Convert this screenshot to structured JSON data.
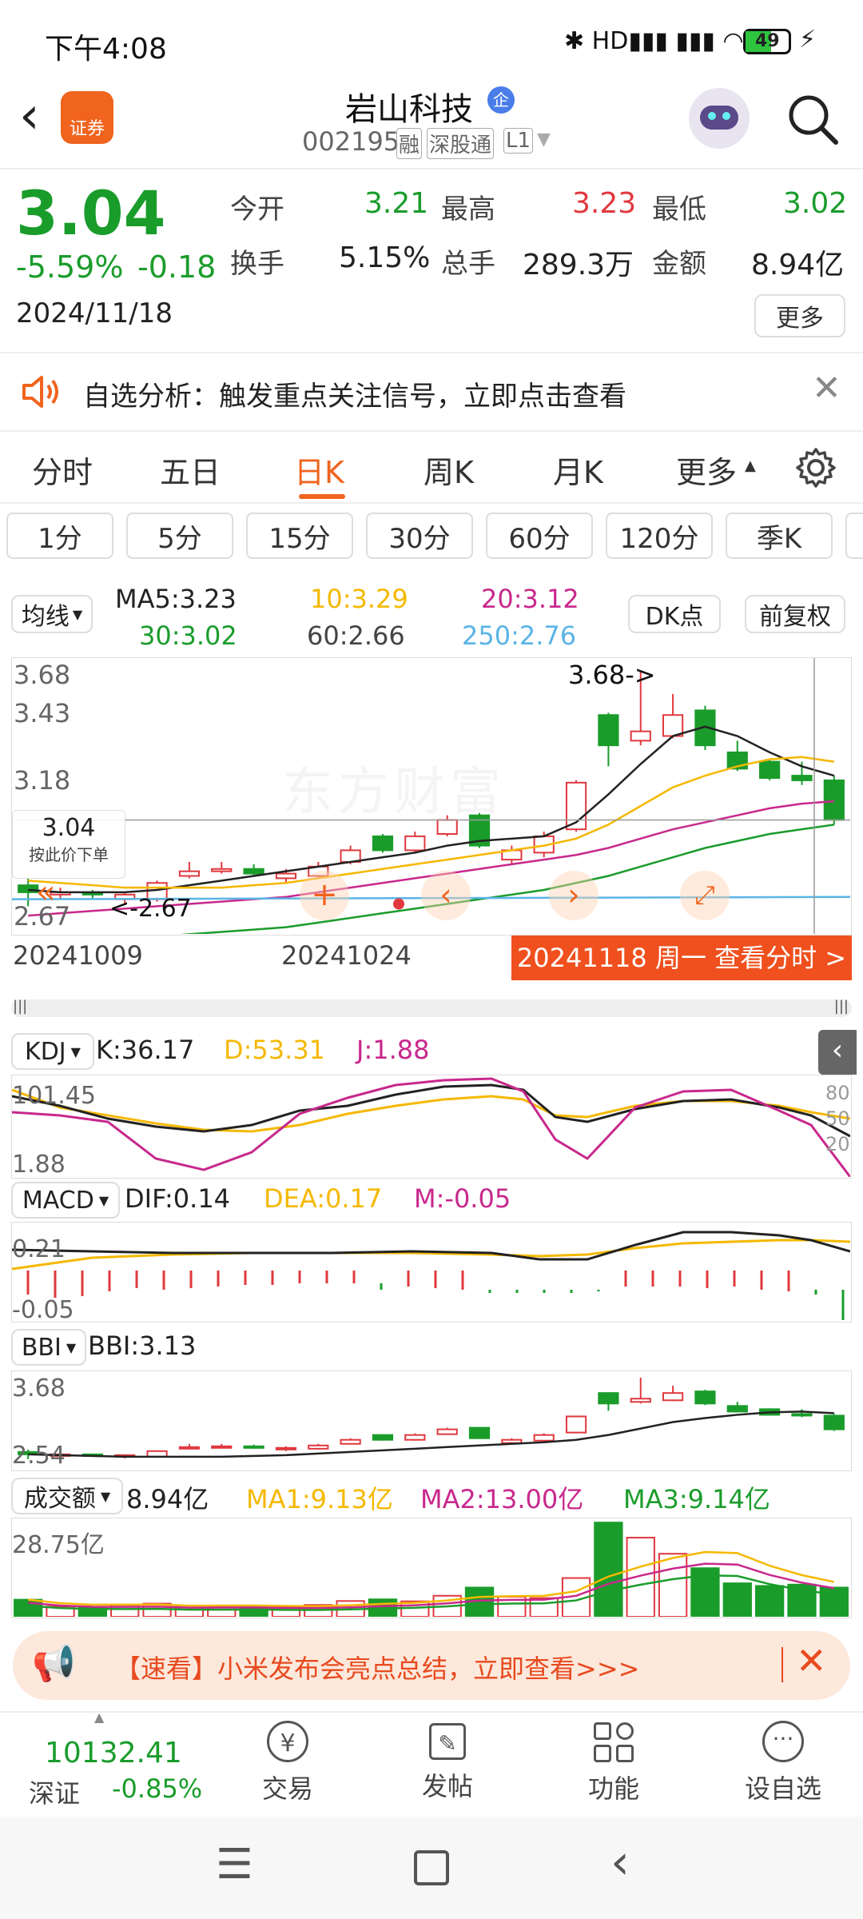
{
  "status": {
    "time": "下午4:08",
    "battery": "49"
  },
  "header": {
    "name": "岩山科技",
    "code": "002195",
    "tags": [
      "融",
      "深股通",
      "L1"
    ],
    "badge": "企",
    "brand": "证券"
  },
  "quote": {
    "price": "3.04",
    "pct": "-5.59%",
    "chg": "-0.18",
    "date": "2024/11/18",
    "fields": [
      {
        "label": "今开",
        "value": "3.21",
        "color": "green"
      },
      {
        "label": "最高",
        "value": "3.23",
        "color": "red"
      },
      {
        "label": "最低",
        "value": "3.02",
        "color": "green"
      },
      {
        "label": "换手",
        "value": "5.15%",
        "color": "black"
      },
      {
        "label": "总手",
        "value": "289.3万",
        "color": "black"
      },
      {
        "label": "金额",
        "value": "8.94亿",
        "color": "black"
      }
    ],
    "more": "更多"
  },
  "notice": {
    "text": "自选分析：触发重点关注信号，立即点击查看"
  },
  "tabs": [
    "分时",
    "五日",
    "日K",
    "周K",
    "月K",
    "更多"
  ],
  "active_tab": "日K",
  "timeframes": [
    "1分",
    "5分",
    "15分",
    "30分",
    "60分",
    "120分",
    "季K"
  ],
  "ma": {
    "selector": "均线",
    "ma5": "MA5:3.23",
    "ma10": "10:3.29",
    "ma20": "20:3.12",
    "ma30": "30:3.02",
    "ma60": "60:2.66",
    "ma250": "250:2.76",
    "dk": "DK点",
    "fq": "前复权"
  },
  "kchart": {
    "y_top": "3.68",
    "y_mid1": "3.43",
    "y_mid2": "3.18",
    "y_bottom": "2.67",
    "cursor_price": "3.04",
    "cursor_hint": "按此价下单",
    "high_note": "3.68->",
    "low_note": "<-2.67",
    "date_left": "20241009",
    "date_mid": "20241024",
    "banner": "20241118 周一 查看分时 >",
    "watermark": "东方财富"
  },
  "kdj": {
    "name": "KDJ",
    "k": "K:36.17",
    "d": "D:53.31",
    "j": "J:1.88",
    "top": "101.45",
    "bottom": "1.88",
    "levels": [
      "80",
      "50",
      "20"
    ]
  },
  "macd": {
    "name": "MACD",
    "dif": "DIF:0.14",
    "dea": "DEA:0.17",
    "m": "M:-0.05",
    "top": "0.21",
    "bottom": "-0.05"
  },
  "bbi": {
    "name": "BBI",
    "value": "BBI:3.13",
    "top": "3.68",
    "bottom": "2.54"
  },
  "vol": {
    "name": "成交额",
    "value": "8.94亿",
    "ma1": "MA1:9.13亿",
    "ma2": "MA2:13.00亿",
    "ma3": "MA3:9.14亿",
    "top": "28.75亿"
  },
  "ad": {
    "text": "【速看】小米发布会亮点总结，立即查看>>>"
  },
  "bottom": {
    "index_value": "10132.41",
    "index_name": "深证",
    "index_pct": "-0.85%",
    "items": [
      "交易",
      "发帖",
      "功能",
      "设自选"
    ]
  },
  "colors": {
    "up": "#e0383e",
    "down": "#1a9c2b",
    "accent": "#f0641e",
    "ma10": "#f5b800",
    "ma20": "#c8288c",
    "ma30": "#1a9c2b",
    "ma250": "#5ab4e6"
  },
  "chart_data": {
    "type": "candlestick",
    "candles": [
      [
        2.76,
        2.73,
        2.79,
        2.67
      ],
      [
        2.72,
        2.73,
        2.75,
        2.7
      ],
      [
        2.73,
        2.72,
        2.74,
        2.7
      ],
      [
        2.7,
        2.72,
        2.73,
        2.68
      ],
      [
        2.7,
        2.77,
        2.78,
        2.69
      ],
      [
        2.8,
        2.82,
        2.86,
        2.79
      ],
      [
        2.82,
        2.83,
        2.86,
        2.81
      ],
      [
        2.83,
        2.81,
        2.85,
        2.8
      ],
      [
        2.79,
        2.81,
        2.83,
        2.77
      ],
      [
        2.8,
        2.84,
        2.86,
        2.79
      ],
      [
        2.86,
        2.91,
        2.93,
        2.85
      ],
      [
        2.97,
        2.91,
        2.98,
        2.9
      ],
      [
        2.91,
        2.97,
        2.99,
        2.9
      ],
      [
        2.98,
        3.04,
        3.06,
        2.97
      ],
      [
        3.06,
        2.93,
        3.07,
        2.92
      ],
      [
        2.87,
        2.91,
        2.93,
        2.85
      ],
      [
        2.9,
        2.97,
        2.99,
        2.88
      ],
      [
        3.0,
        3.2,
        3.21,
        2.99
      ],
      [
        3.49,
        3.36,
        3.5,
        3.27
      ],
      [
        3.38,
        3.42,
        3.68,
        3.36
      ],
      [
        3.4,
        3.49,
        3.58,
        3.39
      ],
      [
        3.51,
        3.36,
        3.53,
        3.34
      ],
      [
        3.33,
        3.26,
        3.38,
        3.25
      ],
      [
        3.29,
        3.22,
        3.3,
        3.21
      ],
      [
        3.23,
        3.21,
        3.29,
        3.19
      ],
      [
        3.21,
        3.04,
        3.23,
        3.02
      ]
    ],
    "ma5": [
      2.74,
      2.73,
      2.73,
      2.73,
      2.74,
      2.76,
      2.78,
      2.8,
      2.82,
      2.84,
      2.86,
      2.88,
      2.9,
      2.93,
      2.95,
      2.96,
      2.97,
      3.03,
      3.15,
      3.28,
      3.4,
      3.44,
      3.4,
      3.33,
      3.27,
      3.23
    ],
    "ma10": [
      2.78,
      2.77,
      2.76,
      2.75,
      2.75,
      2.75,
      2.75,
      2.76,
      2.77,
      2.79,
      2.81,
      2.83,
      2.85,
      2.87,
      2.89,
      2.91,
      2.93,
      2.96,
      3.02,
      3.1,
      3.18,
      3.23,
      3.27,
      3.3,
      3.31,
      3.29
    ],
    "ma20": [
      2.63,
      2.64,
      2.65,
      2.66,
      2.67,
      2.68,
      2.69,
      2.7,
      2.71,
      2.73,
      2.75,
      2.77,
      2.79,
      2.81,
      2.83,
      2.85,
      2.87,
      2.89,
      2.92,
      2.96,
      3.0,
      3.03,
      3.06,
      3.09,
      3.11,
      3.12
    ],
    "ma30": [
      2.5,
      2.51,
      2.52,
      2.53,
      2.54,
      2.55,
      2.56,
      2.57,
      2.58,
      2.6,
      2.62,
      2.64,
      2.66,
      2.68,
      2.7,
      2.72,
      2.74,
      2.77,
      2.8,
      2.84,
      2.88,
      2.92,
      2.95,
      2.98,
      3.0,
      3.02
    ]
  }
}
